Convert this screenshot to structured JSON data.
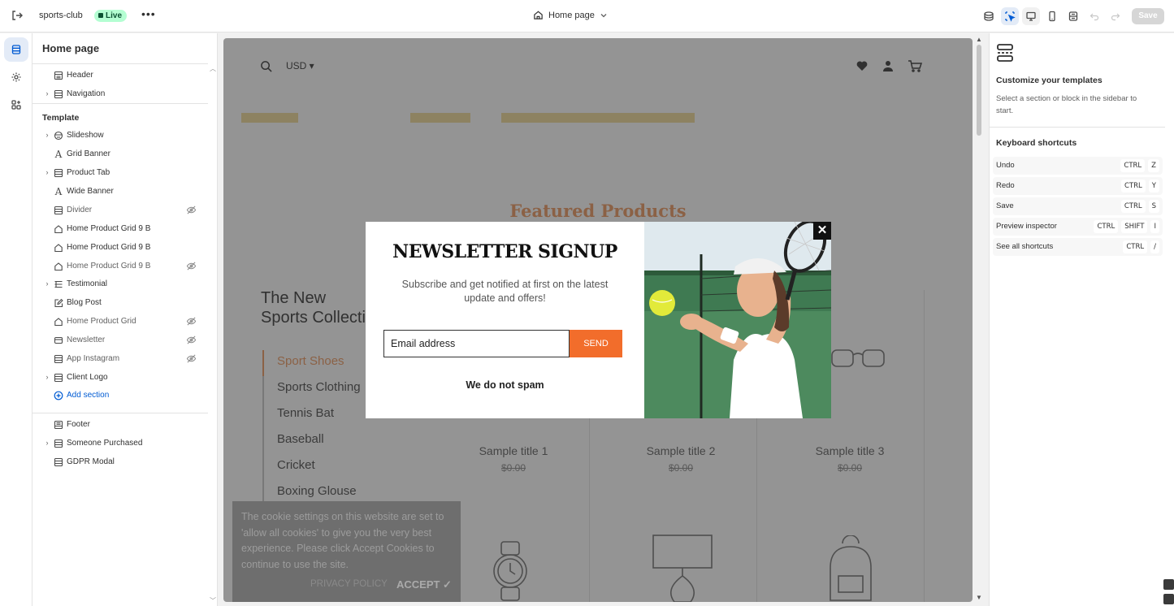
{
  "topbar": {
    "store_name": "sports-club",
    "status_badge": "Live",
    "page_selector": "Home page",
    "save_label": "Save"
  },
  "sidebar": {
    "title": "Home page",
    "header_items": [
      {
        "label": "Header"
      },
      {
        "label": "Navigation"
      }
    ],
    "template_heading": "Template",
    "template_items": [
      {
        "label": "Slideshow"
      },
      {
        "label": "Grid Banner"
      },
      {
        "label": "Product Tab"
      },
      {
        "label": "Wide Banner"
      },
      {
        "label": "Divider"
      },
      {
        "label": "Home Product Grid 9 B"
      },
      {
        "label": "Home Product Grid 9 B"
      },
      {
        "label": "Home Product Grid 9 B"
      },
      {
        "label": "Testimonial"
      },
      {
        "label": "Blog Post"
      },
      {
        "label": "Home Product Grid"
      },
      {
        "label": "Newsletter"
      },
      {
        "label": "App Instagram"
      },
      {
        "label": "Client Logo"
      }
    ],
    "add_section": "Add section",
    "footer_items": [
      {
        "label": "Footer"
      },
      {
        "label": "Someone Purchased"
      },
      {
        "label": "GDPR Modal"
      }
    ]
  },
  "preview": {
    "currency": "USD",
    "featured_title": "Featured Products",
    "collection_title_line1": "The New",
    "collection_title_line2": "Sports Collection",
    "categories": [
      "Sport Shoes",
      "Sports Clothing",
      "Tennis Bat",
      "Baseball",
      "Cricket",
      "Boxing Glouse"
    ],
    "products": [
      {
        "title": "Sample title 1",
        "price": "$0.00"
      },
      {
        "title": "Sample title 2",
        "price": "$0.00"
      },
      {
        "title": "Sample title 3",
        "price": "$0.00"
      }
    ],
    "cookie": {
      "text": "The cookie settings on this website are set to 'allow all cookies' to give you the very best experience. Please click Accept Cookies to continue to use the site.",
      "policy": "PRIVACY POLICY",
      "accept": "ACCEPT ✓"
    },
    "newsletter": {
      "title": "NEWSLETTER SIGNUP",
      "subtitle": "Subscribe and get notified at first on the latest update and offers!",
      "email_placeholder": "Email address",
      "send_label": "SEND",
      "no_spam": "We do not spam"
    }
  },
  "right_panel": {
    "heading": "Customize your templates",
    "description": "Select a section or block in the sidebar to start.",
    "shortcuts_heading": "Keyboard shortcuts",
    "shortcuts": [
      {
        "label": "Undo",
        "keys": [
          "CTRL",
          "Z"
        ]
      },
      {
        "label": "Redo",
        "keys": [
          "CTRL",
          "Y"
        ]
      },
      {
        "label": "Save",
        "keys": [
          "CTRL",
          "S"
        ]
      },
      {
        "label": "Preview inspector",
        "keys": [
          "CTRL",
          "SHIFT",
          "I"
        ]
      },
      {
        "label": "See all shortcuts",
        "keys": [
          "CTRL",
          "/"
        ]
      }
    ]
  }
}
